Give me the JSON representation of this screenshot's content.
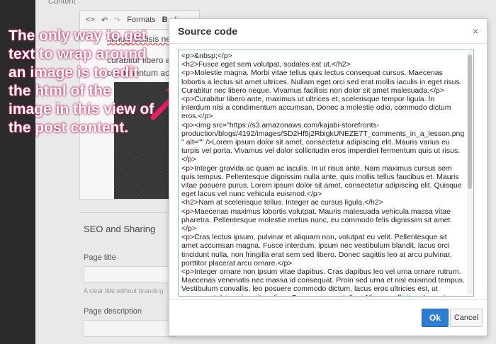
{
  "background": {
    "content_label": "Content",
    "toolbar": {
      "code_icon": "<>",
      "undo_icon": "↶",
      "redo_icon": "↷",
      "formats_label": "Formats",
      "bold_icon": "B",
      "italic_icon": "I"
    },
    "editor_lines": [
      "ximus facilisis nec",
      "curabitur libero an",
      "condimentum accu"
    ],
    "seo_heading": "SEO and Sharing",
    "page_title_label": "Page title",
    "page_title_help": "A clear title without branding",
    "page_description_label": "Page description"
  },
  "annotation": {
    "text": "The only way to get text to wrap around an image is to edit the html of the image in this view of the post content.",
    "arrow_color": "#e91e63"
  },
  "modal": {
    "title": "Source code",
    "close_icon": "×",
    "code": "<p>&nbsp;</p>\n<h2>Fusce eget sem volutpat, sodales est ut.</h2>\n<p>Molestie magna. Morbi vitae tellus quis lectus consequat cursus. Maecenas lobortis a lectus sit amet ultrices. Nullam eget orci sed erat mollis iaculis in eget risus. Curabitur nec libero neque. Vivamus facilisis non dolor sit amet malesuada.</p>\n<p>Curabitur libero ante, maximus ut ultrices et, scelerisque tempor ligula. In interdum nisi a condimentum accumsan. Donec a molestie odio, commodo dictum eros.</p>\n<p><img src=\"https://s3.amazonaws.com/kajabi-storefronts-production/blogs/4192/images/SD2Hf5j2RbigkUNEZE7T_comments_in_a_lesson.png\" alt=\"\" />Lorem ipsum dolor sit amet, consectetur adipiscing elit. Mauris varius eu turpis vel porta. Vivamus vel dolor sollicitudin eros imperdiet fermentum quis ut risus.</p>\n<p>Integer gravida ac quam ac iaculis. In ut risus ante. Nam maximus cursus sem quis tempus. Pellentesque dignissim nulla ante, quis mollis tellus faucibus et. Mauris vitae posuere purus. Lorem ipsum dolor sit amet, consectetur adipiscing elit. Quisque eget lacus vel nunc vehicula euismod.</p>\n<h2>Nam at scelerisque tellus. Integer ac cursus ligula.</h2>\n<p>Maecenas maximus lobortis volutpat. Mauris malesuada vehicula massa vitae pharetra. Pellentesque molestie metus nunc, eu commodo felis dignissim sit amet.</p>\n<p>Cras lectus ipsum, pulvinar et aliquam non, volutpat eu velit. Pellentesque sit amet accumsan magna. Fusce interdum, ipsum nec vestibulum blandit, lacus orci tincidunt nulla, non fringilla erat sem sed libero. Donec sagittis leo at arcu pulvinar, porttitor placerat arcu ornare.</p>\n<p>Integer ornare non ipsum vitae dapibus. Cras dapibus leo vel urna ornare rutrum. Maecenas venenatis nec massa id consequat. Proin sed urna et nisl euismod tempus. Vestibulum convallis, leo posuere commodo dictum, lacus eros ultricies est, ut consequat dui sapien vitae diam. Fusce a augue tellus. Aliquam efficitur placerat malesuada. Praesent interdum sapien imperdiet lobortis vulputate. Integer ac eleifend nisi.</p>\n<p>Maecenas ac velit efficitur, mattis quam in, fermentum tellus. Donec id aliquam eros. Vestibulum odio purus, sollicitudin eu risus at, mollis dapibus nisi. Maecenas quis lorem ex. Sed accumsan laoreet libero, ut porta odio egestas id. Phasellus viverra augue non placerat feugiat.</p>",
    "ok_label": "Ok",
    "cancel_label": "Cancel"
  }
}
